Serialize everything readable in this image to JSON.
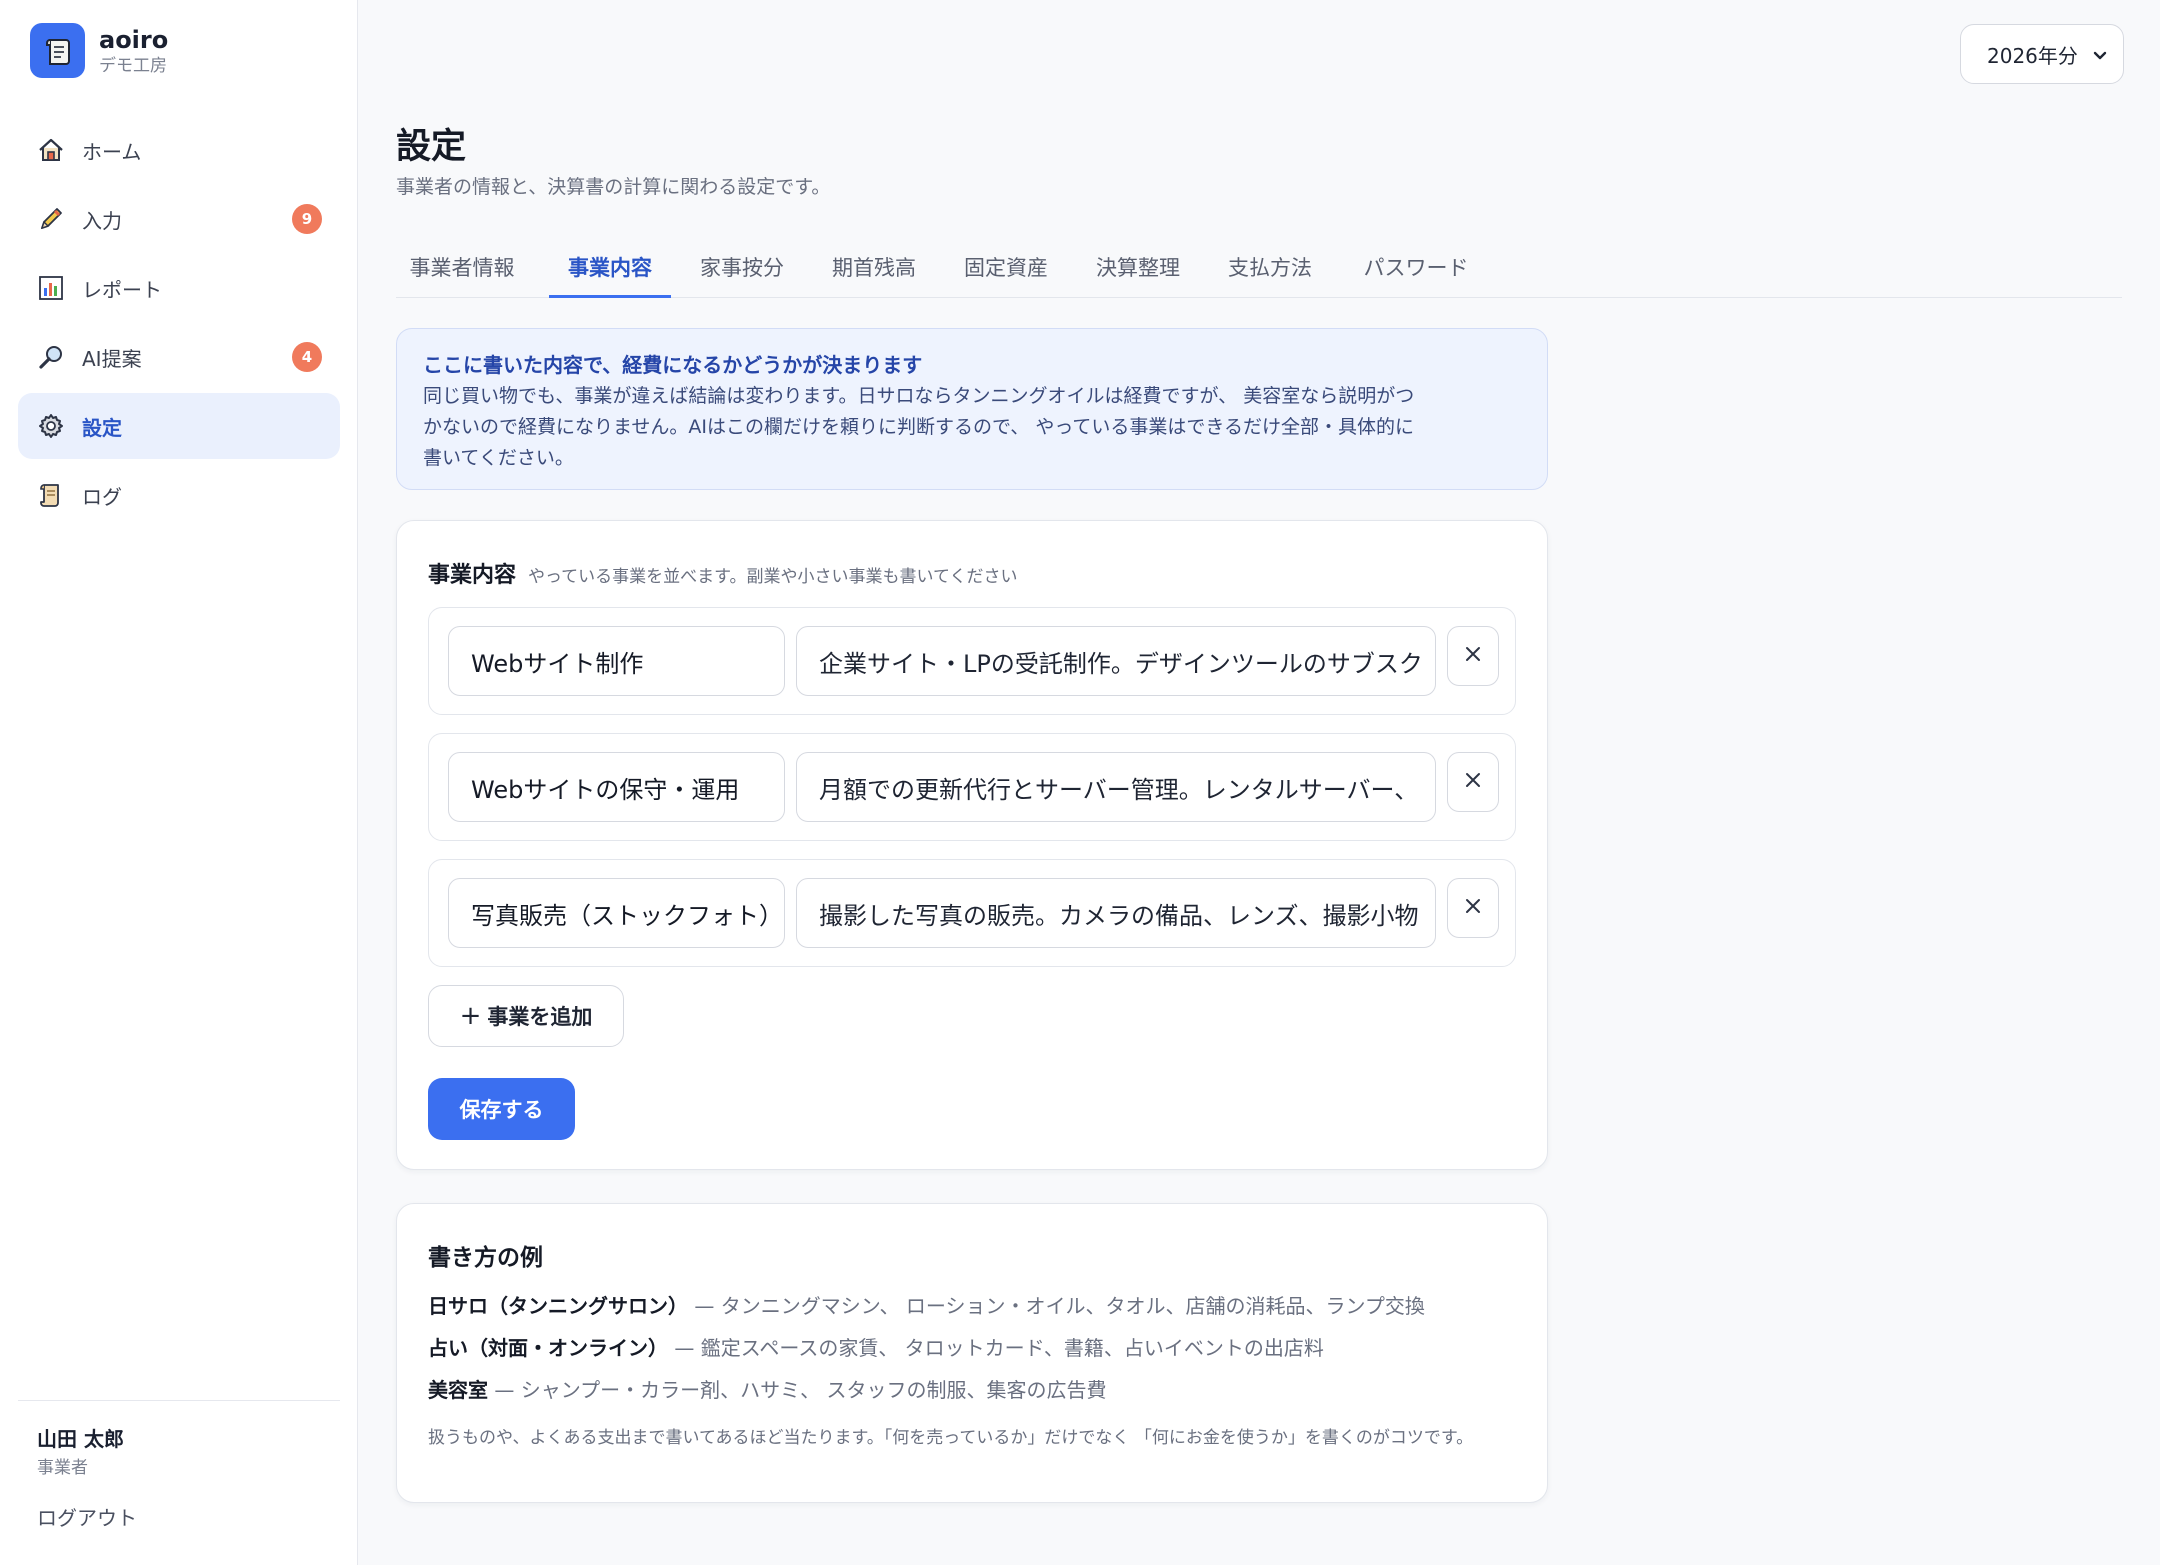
{
  "brand": {
    "name": "aoiro",
    "sub": "デモ工房"
  },
  "sidebar": {
    "items": [
      {
        "label": "ホーム",
        "icon": "home-icon"
      },
      {
        "label": "入力",
        "icon": "pencil-icon",
        "badge": "9"
      },
      {
        "label": "レポート",
        "icon": "chart-icon"
      },
      {
        "label": "AI提案",
        "icon": "magnifier-icon",
        "badge": "4"
      },
      {
        "label": "設定",
        "icon": "gear-icon",
        "active": true
      },
      {
        "label": "ログ",
        "icon": "scroll-icon"
      }
    ]
  },
  "user": {
    "name": "山田 太郎",
    "role": "事業者",
    "logout": "ログアウト"
  },
  "year_select": {
    "value": "2026年分"
  },
  "header": {
    "title": "設定",
    "subtitle": "事業者の情報と、決算書の計算に関わる設定です。"
  },
  "tabs": [
    {
      "label": "事業者情報"
    },
    {
      "label": "事業内容",
      "active": true
    },
    {
      "label": "家事按分"
    },
    {
      "label": "期首残高"
    },
    {
      "label": "固定資産"
    },
    {
      "label": "決算整理"
    },
    {
      "label": "支払方法"
    },
    {
      "label": "パスワード"
    }
  ],
  "info": {
    "title": "ここに書いた内容で、経費になるかどうかが決まります",
    "line1": "同じ買い物でも、事業が違えば結論は変わります。日サロならタンニングオイルは経費ですが、 美容室なら説明がつ",
    "line2": "かないので経費になりません。AIはこの欄だけを頼りに判断するので、 やっている事業はできるだけ全部・具体的に",
    "line3": "書いてください。"
  },
  "business": {
    "title": "事業内容",
    "hint": "やっている事業を並べます。副業や小さい事業も書いてください",
    "rows": [
      {
        "name": "Webサイト制作",
        "desc": "企業サイト・LPの受託制作。デザインツールのサブスク"
      },
      {
        "name": "Webサイトの保守・運用",
        "desc": "月額での更新代行とサーバー管理。レンタルサーバー、"
      },
      {
        "name": "写真販売（ストックフォト）",
        "desc": "撮影した写真の販売。カメラの備品、レンズ、撮影小物"
      }
    ],
    "add_label": "事業を追加",
    "save_label": "保存する"
  },
  "examples": {
    "title": "書き方の例",
    "items": [
      {
        "name": "日サロ（タンニングサロン）",
        "rest": " — タンニングマシン、 ローション・オイル、タオル、店舗の消耗品、ランプ交換"
      },
      {
        "name": "占い（対面・オンライン）",
        "rest": " — 鑑定スペースの家賃、 タロットカード、書籍、占いイベントの出店料"
      },
      {
        "name": "美容室",
        "rest": " — シャンプー・カラー剤、ハサミ、 スタッフの制服、集客の広告費"
      }
    ],
    "note": "扱うものや、よくある支出まで書いてあるほど当たります。「何を売っているか」だけでなく 「何にお金を使うか」を書くのがコツです。"
  },
  "colors": {
    "accent": "#3b6ff0",
    "badge": "#f07a5c",
    "info_bg": "#eef3fe"
  }
}
